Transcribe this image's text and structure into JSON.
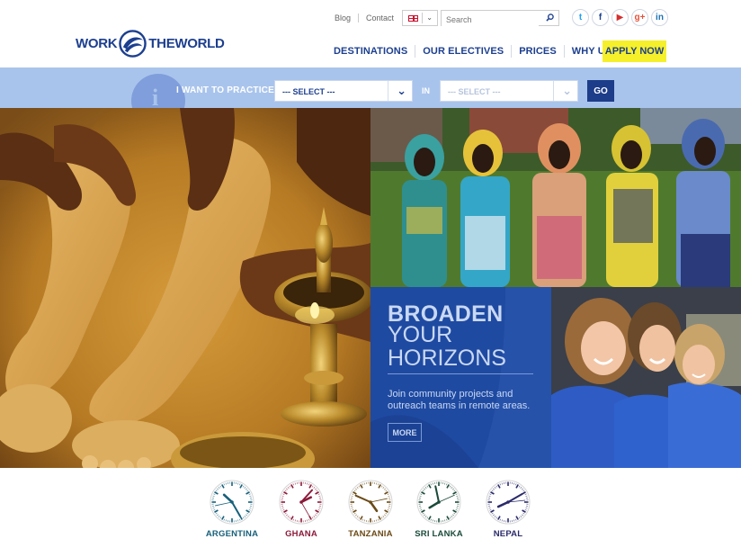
{
  "logo": {
    "left_text": "WORK",
    "right_text": "THEWORLD"
  },
  "utility": {
    "blog": "Blog",
    "contact": "Contact",
    "search_placeholder": "Search"
  },
  "social": [
    {
      "name": "twitter-icon",
      "glyph": "t",
      "color": "#1da1f2"
    },
    {
      "name": "facebook-icon",
      "glyph": "f",
      "color": "#1c3f8f"
    },
    {
      "name": "youtube-icon",
      "glyph": "▶",
      "color": "#d32f2f"
    },
    {
      "name": "google-plus-icon",
      "glyph": "g+",
      "color": "#e5533d"
    },
    {
      "name": "linkedin-icon",
      "glyph": "in",
      "color": "#1c72b0"
    }
  ],
  "nav": {
    "destinations": "DESTINATIONS",
    "electives": "OUR ELECTIVES",
    "prices": "PRICES",
    "why_us": "WHY US?",
    "apply": "APPLY NOW"
  },
  "practice_search": {
    "label": "I WANT TO PRACTICE",
    "select1": "--- SELECT ---",
    "in_label": "IN",
    "select2": "--- SELECT ---",
    "go": "GO"
  },
  "promo": {
    "title_line1": "BROADEN",
    "title_line2": "YOUR HORIZONS",
    "body": "Join community projects and outreach teams in remote areas.",
    "more": "MORE"
  },
  "clocks": [
    {
      "city": "ARGENTINA",
      "color": "#17607a",
      "hour": 10,
      "minute": 25,
      "second": 43
    },
    {
      "city": "GHANA",
      "color": "#8b1a3a",
      "hour": 2,
      "minute": 7,
      "second": 25
    },
    {
      "city": "TANZANIA",
      "color": "#6b4a16",
      "hour": 4,
      "minute": 49,
      "second": 13
    },
    {
      "city": "SRI LANKA",
      "color": "#1a4a3a",
      "hour": 7,
      "minute": 58,
      "second": 11
    },
    {
      "city": "NEPAL",
      "color": "#2a2a6a",
      "hour": 8,
      "minute": 10,
      "second": 14
    }
  ]
}
